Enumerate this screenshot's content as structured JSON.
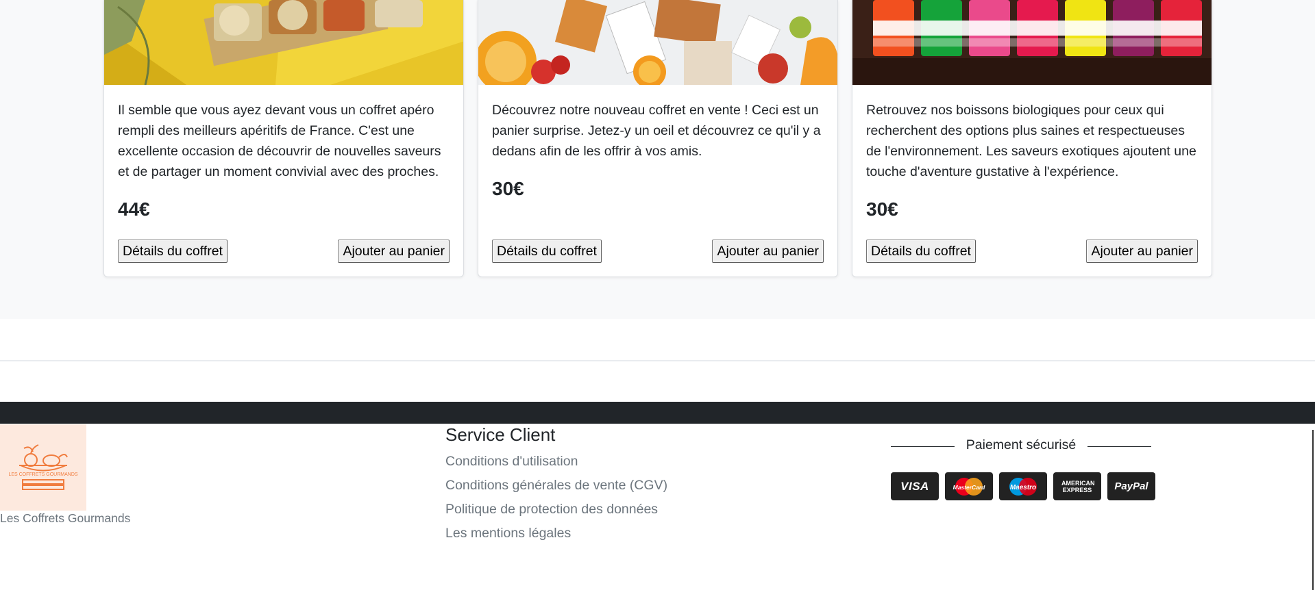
{
  "products": [
    {
      "description": "Il semble que vous ayez devant vous un coffret apéro rempli des meilleurs apéritifs de France. C'est une excellente occasion de découvrir de nouvelles saveurs et de partager un moment convivial avec des proches.",
      "price": "44€",
      "details_label": "Détails du coffret",
      "cart_label": "Ajouter au panier"
    },
    {
      "description": "Découvrez notre nouveau coffret en vente ! Ceci est un panier surprise. Jetez-y un oeil et découvrez ce qu'il y a dedans afin de les offrir à vos amis.",
      "price": "30€",
      "details_label": "Détails du coffret",
      "cart_label": "Ajouter au panier"
    },
    {
      "description": "Retrouvez nos boissons biologiques pour ceux qui recherchent des options plus saines et respectueuses de l'environnement. Les saveurs exotiques ajoutent une touche d'aventure gustative à l'expérience.",
      "price": "30€",
      "details_label": "Détails du coffret",
      "cart_label": "Ajouter au panier"
    }
  ],
  "footer": {
    "logo_text": "LES COFFRETS GOURMANDS",
    "brand_name": "Les Coffrets Gourmands",
    "service_title": "Service Client",
    "links": [
      "Conditions d'utilisation",
      "Conditions générales de vente (CGV)",
      "Politique de protection des données",
      "Les mentions légales"
    ],
    "payment_title": "Paiement sécurisé",
    "payment_methods": [
      "VISA",
      "MasterCard",
      "Maestro",
      "AMERICAN EXPRESS",
      "PayPal"
    ]
  },
  "colors": {
    "page_bg": "#f8f9fa",
    "footer_dark": "#212529",
    "logo_orange": "#f07c3e",
    "muted_text": "#6c757d"
  }
}
